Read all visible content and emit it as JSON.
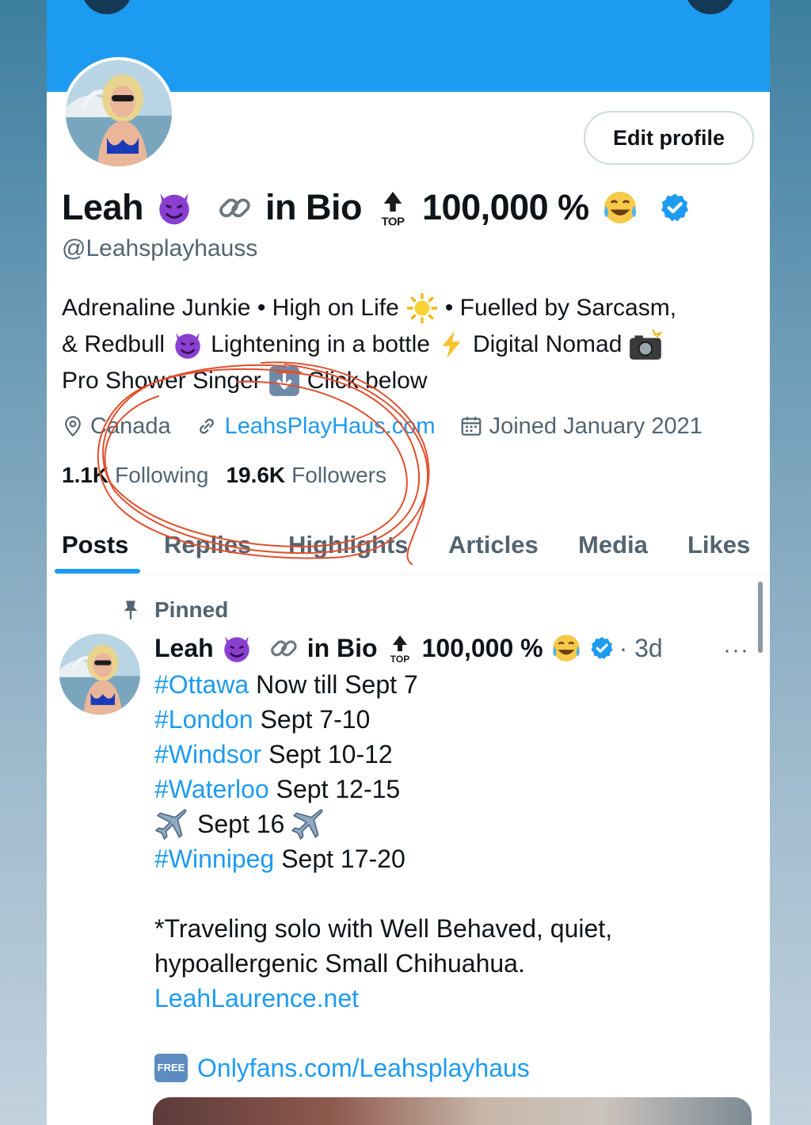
{
  "profile": {
    "edit_label": "Edit profile",
    "name_parts": [
      "Leah",
      "in Bio",
      "100,000 %"
    ],
    "handle": "@Leahsplayhauss",
    "bio": {
      "l1a": "Adrenaline Junkie • High on Life",
      "l1b": "• Fuelled by Sarcasm,",
      "l2a": "& Redbull",
      "l2b": "Lightening in a bottle",
      "l2c": "Digital Nomad",
      "l3a": "Pro Shower Singer",
      "l3b": "Click below"
    },
    "location": "Canada",
    "website": "LeahsPlayHaus.com",
    "joined": "Joined January 2021",
    "following_count": "1.1K",
    "following_label": "Following",
    "followers_count": "19.6K",
    "followers_label": "Followers"
  },
  "tabs": [
    "Posts",
    "Replies",
    "Highlights",
    "Articles",
    "Media",
    "Likes"
  ],
  "active_tab": "Posts",
  "pinned_post": {
    "pinned_label": "Pinned",
    "name_parts": [
      "Leah",
      "in Bio",
      "100,000 %"
    ],
    "time": "· 3d",
    "more": "···",
    "lines": [
      {
        "tag": "#Ottawa",
        "text": "Now till Sept 7"
      },
      {
        "tag": "#London",
        "text": "Sept 7-10"
      },
      {
        "tag": "#Windsor",
        "text": "Sept 10-12"
      },
      {
        "tag": "#Waterloo",
        "text": "Sept 12-15"
      },
      {
        "text": "Sept 16"
      },
      {
        "tag": "#Winnipeg",
        "text": "Sept 17-20"
      }
    ],
    "note_l1": "*Traveling solo with Well Behaved, quiet,",
    "note_l2": "hypoallergenic Small Chihuahua.",
    "link1": "LeahLaurence.net",
    "free_badge": "FREE",
    "link2": "Onlyfans.com/Leahsplayhaus"
  },
  "icons": {
    "verified": "verified-badge-icon",
    "devil": "smiling-devil-emoji",
    "link": "link-emoji",
    "top": "top-arrow-emoji",
    "laugh": "tears-of-joy-emoji",
    "sun": "sun-emoji",
    "zap": "lightning-emoji",
    "camera": "camera-flash-emoji",
    "down": "down-arrow-emoji",
    "plane": "airplane-emoji",
    "pin": "pin-icon",
    "location": "location-icon",
    "calendar": "calendar-icon"
  },
  "colors": {
    "accent": "#1d9bf0",
    "text": "#0f1419",
    "muted": "#536471",
    "annotation": "#e0502e"
  }
}
